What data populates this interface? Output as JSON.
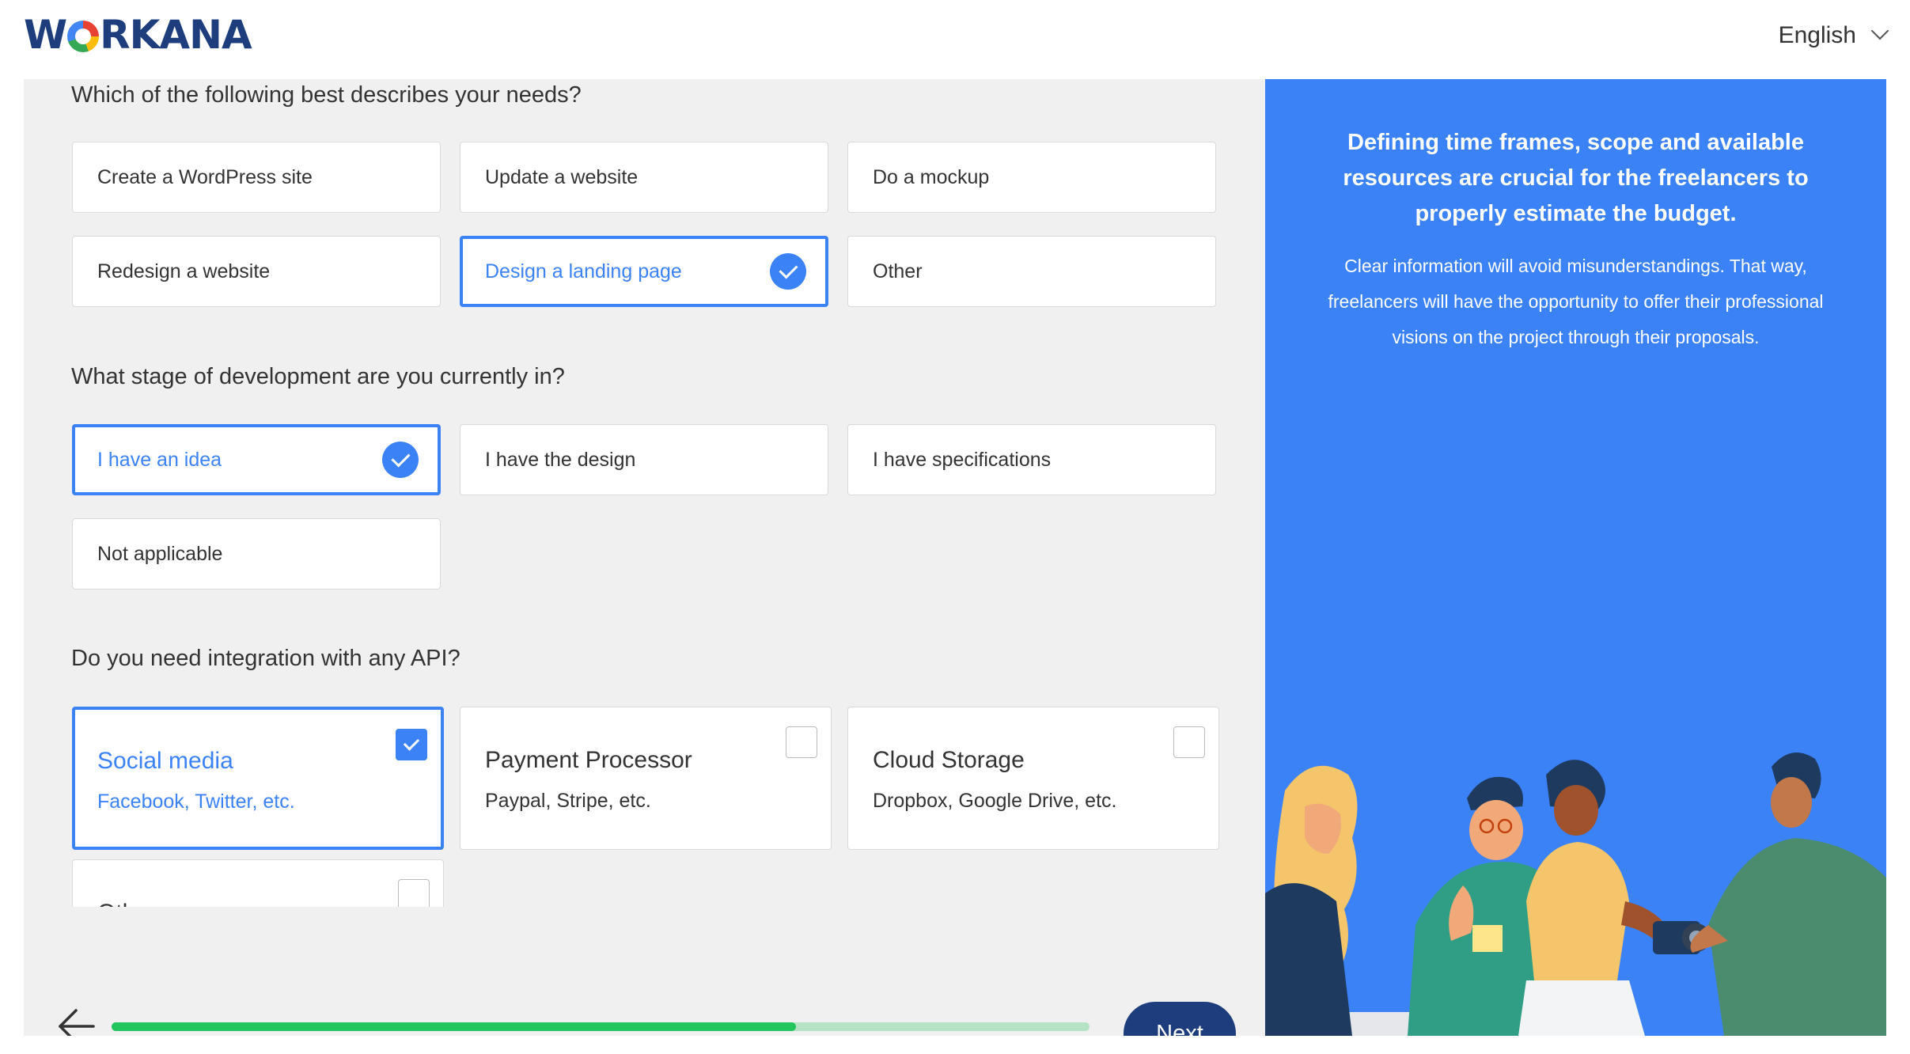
{
  "header": {
    "logo_text": "WORKANA",
    "language": "English"
  },
  "questions": [
    {
      "title": "Which of the following best describes your needs?",
      "options": [
        {
          "label": "Create a WordPress site",
          "selected": false
        },
        {
          "label": "Update a website",
          "selected": false
        },
        {
          "label": "Do a mockup",
          "selected": false
        },
        {
          "label": "Redesign a website",
          "selected": false
        },
        {
          "label": "Design a landing page",
          "selected": true
        },
        {
          "label": "Other",
          "selected": false
        }
      ]
    },
    {
      "title": "What stage of development are you currently in?",
      "options": [
        {
          "label": "I have an idea",
          "selected": true
        },
        {
          "label": "I have the design",
          "selected": false
        },
        {
          "label": "I have specifications",
          "selected": false
        },
        {
          "label": "Not applicable",
          "selected": false
        }
      ]
    },
    {
      "title": "Do you need integration with any API?",
      "options": [
        {
          "label": "Social media",
          "sublabel": "Facebook, Twitter, etc.",
          "checked": true
        },
        {
          "label": "Payment Processor",
          "sublabel": "Paypal, Stripe, etc.",
          "checked": false
        },
        {
          "label": "Cloud Storage",
          "sublabel": "Dropbox, Google Drive, etc.",
          "checked": false
        },
        {
          "label": "Other",
          "checked": false
        }
      ]
    }
  ],
  "footer": {
    "next_label": "Next",
    "progress": 0.7
  },
  "sidebar": {
    "title": "Defining time frames, scope and available resources are crucial for the freelancers to properly estimate the budget.",
    "body": "Clear information will avoid misunderstandings. That way, freelancers will have the opportunity to offer their professional visions on the project through their proposals."
  },
  "colors": {
    "accent": "#3b82f6",
    "brand_navy": "#1d3d7c",
    "progress_fill": "#22c55e",
    "progress_track": "#b6e2c6"
  }
}
